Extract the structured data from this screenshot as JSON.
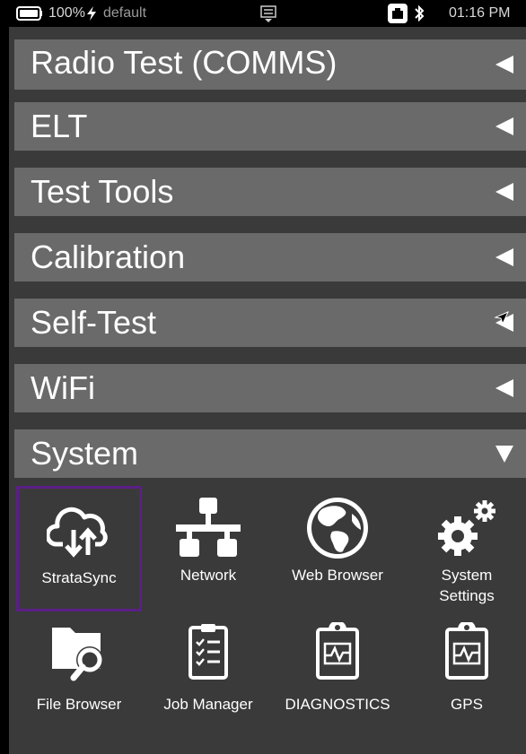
{
  "status_bar": {
    "battery": "100%",
    "profile": "default",
    "time": "01:16 PM",
    "icons": [
      "battery-icon",
      "charging-bolt-icon",
      "keyboard-icon",
      "ethernet-icon",
      "bluetooth-icon"
    ]
  },
  "menu": [
    {
      "label": "Radio Test (COMMS)",
      "state": "collapsed"
    },
    {
      "label": "ELT",
      "state": "collapsed"
    },
    {
      "label": "Test Tools",
      "state": "collapsed"
    },
    {
      "label": "Calibration",
      "state": "collapsed"
    },
    {
      "label": "Self-Test",
      "state": "collapsed"
    },
    {
      "label": "WiFi",
      "state": "collapsed"
    },
    {
      "label": "System",
      "state": "expanded"
    }
  ],
  "system_apps": [
    {
      "label": "StrataSync",
      "icon": "cloud-sync-icon",
      "selected": true
    },
    {
      "label": "Network",
      "icon": "network-icon"
    },
    {
      "label": "Web Browser",
      "icon": "globe-icon"
    },
    {
      "label": "System",
      "label2": "Settings",
      "icon": "gears-icon"
    },
    {
      "label": "File Browser",
      "icon": "folder-search-icon"
    },
    {
      "label": "Job Manager",
      "icon": "clipboard-checklist-icon"
    },
    {
      "label": "DIAGNOSTICS",
      "icon": "clipboard-heartbeat-icon"
    },
    {
      "label": "GPS",
      "icon": "clipboard-heartbeat-icon"
    }
  ],
  "colors": {
    "background": "#3a3a3a",
    "menu_row": "#6a6a6a",
    "status_bar": "#000000",
    "selection_border": "#5b1f86"
  }
}
